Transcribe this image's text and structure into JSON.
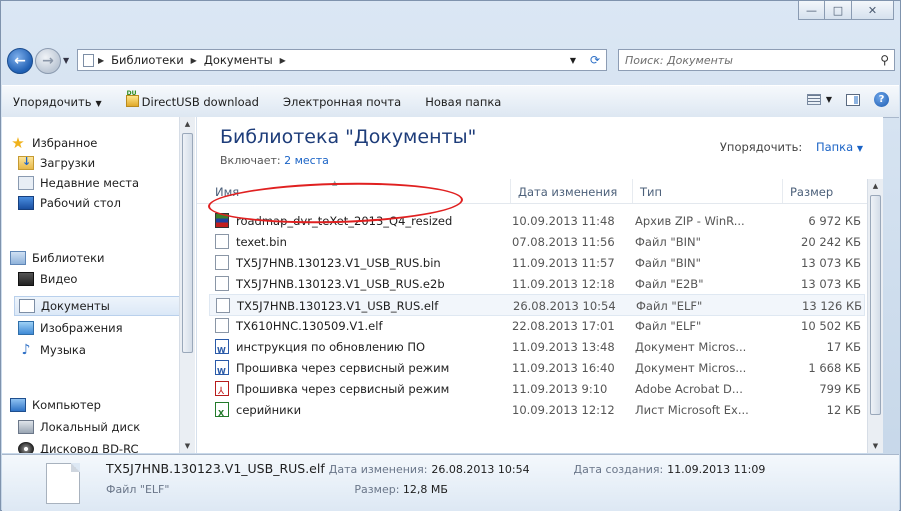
{
  "window": {
    "caption_min": "—",
    "caption_max": "□",
    "caption_close": "✕"
  },
  "address": {
    "crumbs": [
      "Библиотеки",
      "Документы"
    ],
    "search_placeholder": "Поиск: Документы"
  },
  "toolbar": {
    "organize": "Упорядочить",
    "directusb": "DirectUSB download",
    "email": "Электронная почта",
    "newfolder": "Новая папка"
  },
  "nav": {
    "favorites": "Избранное",
    "downloads": "Загрузки",
    "recent": "Недавние места",
    "desktop": "Рабочий стол",
    "libraries": "Библиотеки",
    "video": "Видео",
    "documents": "Документы",
    "images": "Изображения",
    "music": "Музыка",
    "computer": "Компьютер",
    "localdisk": "Локальный диск",
    "bdrom": "Дисковод BD-RC"
  },
  "library": {
    "title": "Библиотека \"Документы\"",
    "includes_label": "Включает:",
    "includes_link": "2 места",
    "arrange_label": "Упорядочить:",
    "arrange_value": "Папка"
  },
  "columns": {
    "name": "Имя",
    "date": "Дата изменения",
    "type": "Тип",
    "size": "Размер"
  },
  "files": [
    {
      "icon": "zip-archive-icon",
      "name": "roadmap_dvr_teXet_2013_Q4_resized",
      "date": "10.09.2013 11:48",
      "type": "Архив ZIP - WinR...",
      "size": "6 972 КБ"
    },
    {
      "icon": "generic-file-icon",
      "name": "texet.bin",
      "date": "07.08.2013 11:56",
      "type": "Файл \"BIN\"",
      "size": "20 242 КБ"
    },
    {
      "icon": "generic-file-icon",
      "name": "TX5J7HNB.130123.V1_USB_RUS.bin",
      "date": "11.09.2013 11:57",
      "type": "Файл \"BIN\"",
      "size": "13 073 КБ"
    },
    {
      "icon": "generic-file-icon",
      "name": "TX5J7HNB.130123.V1_USB_RUS.e2b",
      "date": "11.09.2013 12:18",
      "type": "Файл \"E2B\"",
      "size": "13 073 КБ"
    },
    {
      "icon": "generic-file-icon",
      "name": "TX5J7HNB.130123.V1_USB_RUS.elf",
      "date": "26.08.2013 10:54",
      "type": "Файл \"ELF\"",
      "size": "13 126 КБ"
    },
    {
      "icon": "generic-file-icon",
      "name": "TX610HNC.130509.V1.elf",
      "date": "22.08.2013 17:01",
      "type": "Файл \"ELF\"",
      "size": "10 502 КБ"
    },
    {
      "icon": "word-document-icon",
      "name": "инструкция по обновлению ПО",
      "date": "11.09.2013 13:48",
      "type": "Документ Micros...",
      "size": "17 КБ"
    },
    {
      "icon": "word-document-icon",
      "name": "Прошивка через сервисный режим",
      "date": "11.09.2013 16:40",
      "type": "Документ Micros...",
      "size": "1 668 КБ"
    },
    {
      "icon": "pdf-document-icon",
      "name": "Прошивка через сервисный режим",
      "date": "11.09.2013 9:10",
      "type": "Adobe Acrobat D...",
      "size": "799 КБ"
    },
    {
      "icon": "excel-sheet-icon",
      "name": "серийники",
      "date": "10.09.2013 12:12",
      "type": "Лист Microsoft Ex...",
      "size": "12 КБ"
    }
  ],
  "details": {
    "filename": "TX5J7HNB.130123.V1_USB_RUS.elf",
    "modified_label": "Дата изменения:",
    "modified_value": "26.08.2013 10:54",
    "created_label": "Дата создания:",
    "created_value": "11.09.2013 11:09",
    "filetype": "Файл \"ELF\"",
    "size_label": "Размер:",
    "size_value": "12,8 МБ"
  }
}
